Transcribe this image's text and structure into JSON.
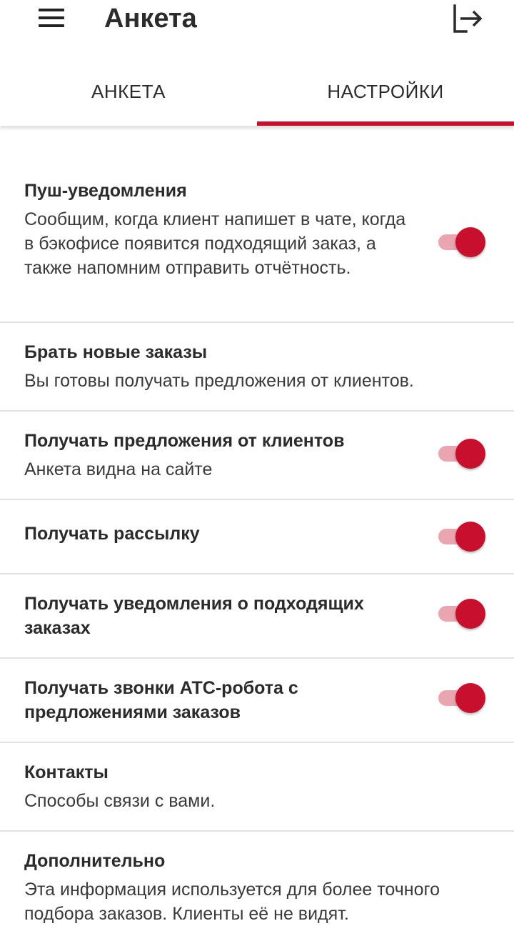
{
  "header": {
    "title": "Анкета",
    "menu_icon": "hamburger-menu-icon",
    "logout_icon": "logout-arrow-icon"
  },
  "tabs": [
    {
      "label": "АНКЕТА",
      "active": false
    },
    {
      "label": "НАСТРОЙКИ",
      "active": true
    }
  ],
  "colors": {
    "accent": "#c8102e",
    "switch_track": "#e9a5b0",
    "divider": "#e2e2e2"
  },
  "settings": [
    {
      "title": "Пуш-уведомления",
      "subtitle": "Сообщим, когда клиент напишет в чате, когда в бэкофисе появится подходящий заказ, а также напомним отправить отчётность.",
      "toggle": true
    },
    {
      "title": "Брать новые заказы",
      "subtitle": "Вы готовы получать предложения от клиентов."
    },
    {
      "title": "Получать предложения от клиентов",
      "subtitle": "Анкета видна на сайте",
      "toggle": true
    },
    {
      "title": "Получать рассылку",
      "toggle": true
    },
    {
      "title": "Получать уведомления о подходящих заказах",
      "toggle": true
    },
    {
      "title": "Получать звонки АТС-робота с предложениями заказов",
      "toggle": true
    },
    {
      "title": "Контакты",
      "subtitle": "Способы связи с вами."
    },
    {
      "title": "Дополнительно",
      "subtitle": "Эта информация используется для более точного подбора заказов. Клиенты её не видят."
    }
  ]
}
